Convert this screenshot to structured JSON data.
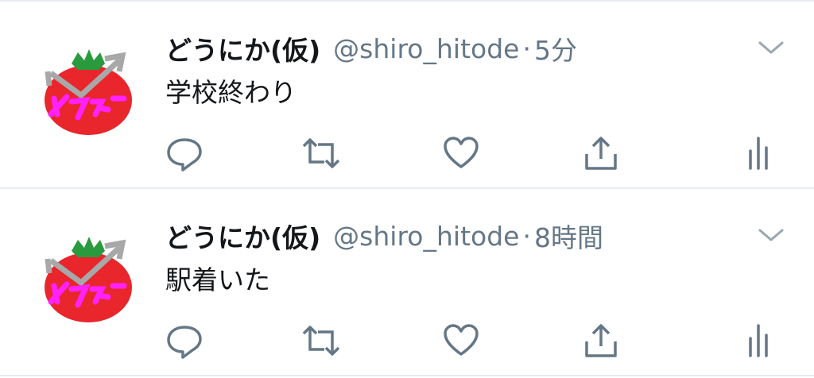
{
  "tweets": [
    {
      "display_name": "どうにか(仮)",
      "handle": "@shiro_hitode",
      "separator": "·",
      "time": "5分",
      "text": "学校終わり"
    },
    {
      "display_name": "どうにか(仮)",
      "handle": "@shiro_hitode",
      "separator": "·",
      "time": "8時間",
      "text": "駅着いた"
    }
  ],
  "avatar": {
    "description_icon": "tomato-avatar",
    "colors": {
      "fruit": "#e8262b",
      "leaf": "#2a9a3e",
      "arrow": "#a8a8a8",
      "scribble": "#ff22ff"
    }
  },
  "icons": {
    "reply": "reply-icon",
    "retweet": "retweet-icon",
    "like": "heart-icon",
    "share": "share-icon",
    "stats": "analytics-icon",
    "caret": "chevron-down-icon"
  },
  "colors": {
    "text": "#14171a",
    "secondary": "#657786",
    "divider": "#e6ecf0"
  }
}
